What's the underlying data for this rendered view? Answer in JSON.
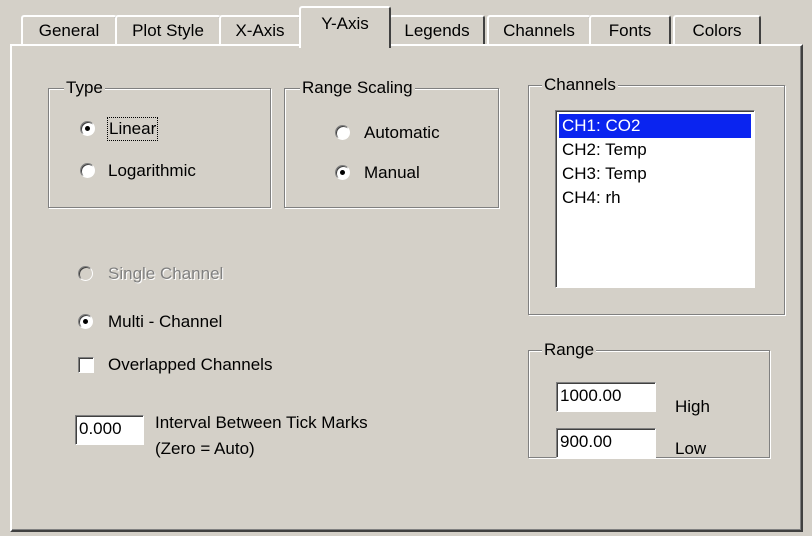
{
  "tabs": [
    {
      "label": "General"
    },
    {
      "label": "Plot Style"
    },
    {
      "label": "X-Axis"
    },
    {
      "label": "Y-Axis",
      "active": true
    },
    {
      "label": "Legends"
    },
    {
      "label": "Channels"
    },
    {
      "label": "Fonts"
    },
    {
      "label": "Colors"
    }
  ],
  "type_group": {
    "label": "Type",
    "options": [
      {
        "label": "Linear",
        "checked": true
      },
      {
        "label": "Logarithmic",
        "checked": false
      }
    ]
  },
  "range_scaling": {
    "label": "Range Scaling",
    "options": [
      {
        "label": "Automatic",
        "checked": false
      },
      {
        "label": "Manual",
        "checked": true
      }
    ]
  },
  "channel_mode": {
    "single": {
      "label": "Single Channel",
      "checked": false,
      "disabled": true
    },
    "multi": {
      "label": "Multi - Channel",
      "checked": true
    }
  },
  "overlapped": {
    "label": "Overlapped Channels",
    "checked": false
  },
  "tick_interval": {
    "value": "0.000",
    "label_line1": "Interval Between Tick Marks",
    "label_line2": "(Zero = Auto)"
  },
  "channels": {
    "label": "Channels",
    "items": [
      "CH1: CO2",
      "CH2: Temp",
      "CH3: Temp",
      "CH4: rh"
    ],
    "selected_index": 0
  },
  "range": {
    "label": "Range",
    "high_value": "1000.00",
    "high_label": "High",
    "low_value": "900.00",
    "low_label": "Low"
  },
  "colors": {
    "dialog_bg": "#d4d0c8",
    "selection": "#0a24f0"
  }
}
